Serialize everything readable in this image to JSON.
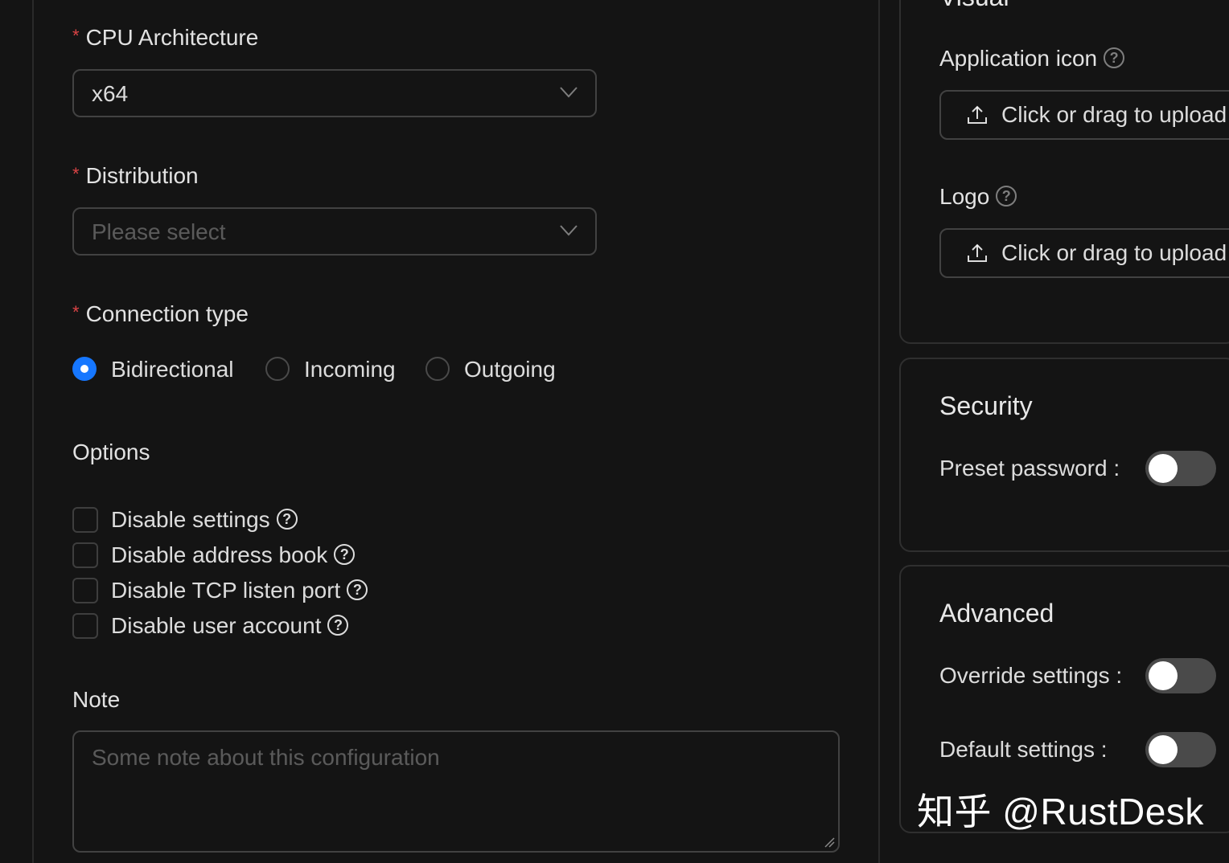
{
  "form": {
    "cpu_architecture": {
      "label": "CPU Architecture",
      "required_mark": "*",
      "value": "x64"
    },
    "distribution": {
      "label": "Distribution",
      "required_mark": "*",
      "placeholder": "Please select"
    },
    "connection_type": {
      "label": "Connection type",
      "required_mark": "*",
      "options": [
        "Bidirectional",
        "Incoming",
        "Outgoing"
      ],
      "selected": "Bidirectional"
    },
    "options": {
      "label": "Options",
      "items": [
        {
          "label": "Disable settings",
          "checked": false
        },
        {
          "label": "Disable address book",
          "checked": false
        },
        {
          "label": "Disable TCP listen port",
          "checked": false
        },
        {
          "label": "Disable user account",
          "checked": false
        }
      ]
    },
    "note": {
      "label": "Note",
      "placeholder": "Some note about this configuration"
    }
  },
  "visual": {
    "title": "Visual",
    "application_icon": {
      "label": "Application icon",
      "upload_text": "Click or drag to upload"
    },
    "logo": {
      "label": "Logo",
      "upload_text": "Click or drag to upload"
    }
  },
  "security": {
    "title": "Security",
    "preset_password": {
      "label": "Preset password :",
      "enabled": false
    }
  },
  "advanced": {
    "title": "Advanced",
    "override_settings": {
      "label": "Override settings :",
      "enabled": false
    },
    "default_settings": {
      "label": "Default settings :",
      "enabled": false
    }
  },
  "watermark": "知乎 @RustDesk",
  "colors": {
    "background": "#141414",
    "accent": "#1677ff",
    "required": "#dc4446",
    "border": "#424242"
  },
  "icons": {
    "select_arrow": "chevron-down-icon",
    "help": "question-circle-icon",
    "upload": "upload-icon"
  }
}
